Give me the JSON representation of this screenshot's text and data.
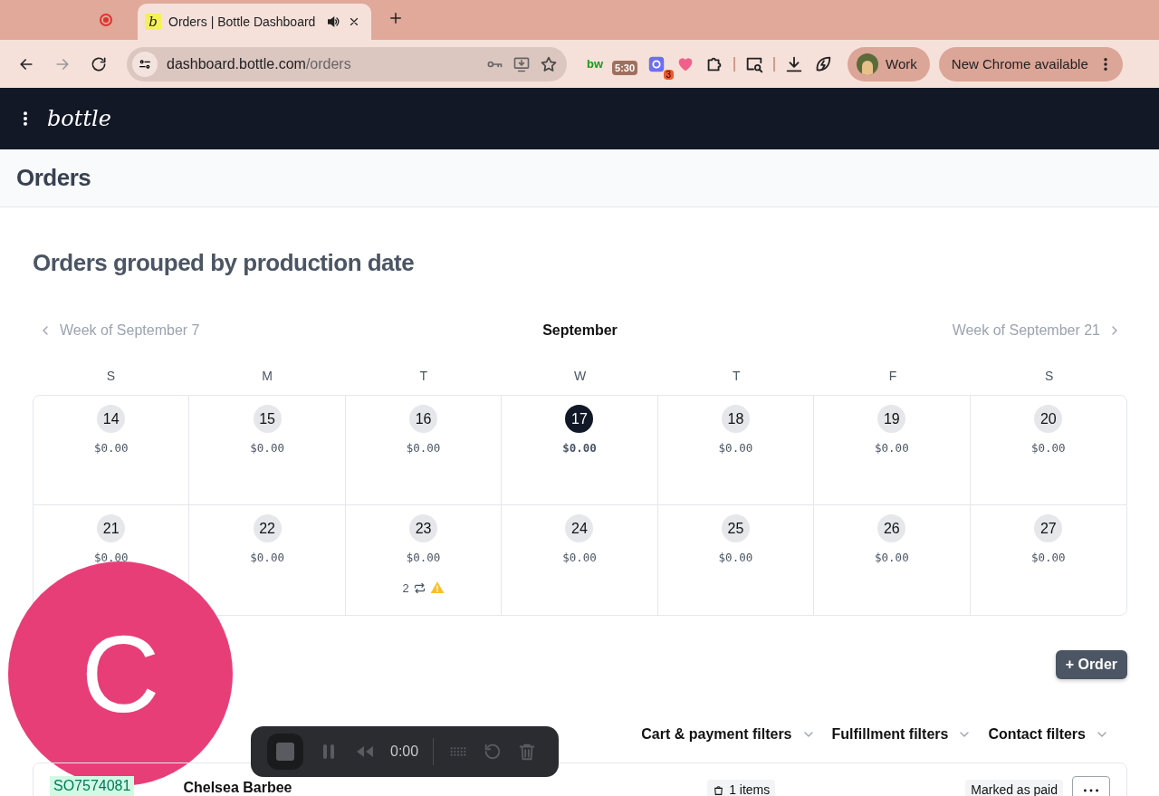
{
  "browser": {
    "tabs": [
      {
        "favicon": "b",
        "title": "Orders | Bottle Dashboard",
        "selected": true,
        "audio": true
      }
    ],
    "address": {
      "host": "dashboard.bottle.com",
      "path": "/orders"
    },
    "extensions": [
      {
        "kind": "text",
        "label": "bw"
      },
      {
        "kind": "timer",
        "label": "5:30"
      },
      {
        "kind": "badge",
        "label": "3"
      }
    ],
    "profile": "Work",
    "update": "New Chrome available"
  },
  "app": {
    "brand": "bottle"
  },
  "page_title": "Orders",
  "section_title": "Orders grouped by production date",
  "calendar": {
    "prev": "Week of September 7",
    "month": "September",
    "next": "Week of September 21",
    "weekdays": [
      "S",
      "M",
      "T",
      "W",
      "T",
      "F",
      "S"
    ],
    "weeks": [
      [
        {
          "day": "14",
          "amount": "$0.00",
          "selected": false
        },
        {
          "day": "15",
          "amount": "$0.00",
          "selected": false
        },
        {
          "day": "16",
          "amount": "$0.00",
          "selected": false
        },
        {
          "day": "17",
          "amount": "$0.00",
          "selected": true
        },
        {
          "day": "18",
          "amount": "$0.00",
          "selected": false
        },
        {
          "day": "19",
          "amount": "$0.00",
          "selected": false
        },
        {
          "day": "20",
          "amount": "$0.00",
          "selected": false
        }
      ],
      [
        {
          "day": "21",
          "amount": "$0.00",
          "selected": false
        },
        {
          "day": "22",
          "amount": "$0.00",
          "selected": false
        },
        {
          "day": "23",
          "amount": "$0.00",
          "selected": false,
          "recurring": "2",
          "warning": true
        },
        {
          "day": "24",
          "amount": "$0.00",
          "selected": false
        },
        {
          "day": "25",
          "amount": "$0.00",
          "selected": false
        },
        {
          "day": "26",
          "amount": "$0.00",
          "selected": false
        },
        {
          "day": "27",
          "amount": "$0.00",
          "selected": false
        }
      ]
    ]
  },
  "new_order_button": "+ Order",
  "filters": [
    "Cart & payment filters",
    "Fulfillment filters",
    "Contact filters"
  ],
  "orders": [
    {
      "id": "SO7574081",
      "customer": "Chelsea Barbee",
      "items": "1 items",
      "status": "Marked as paid"
    }
  ],
  "recorder": {
    "time": "0:00"
  },
  "camera_bubble": {
    "initial": "C"
  }
}
